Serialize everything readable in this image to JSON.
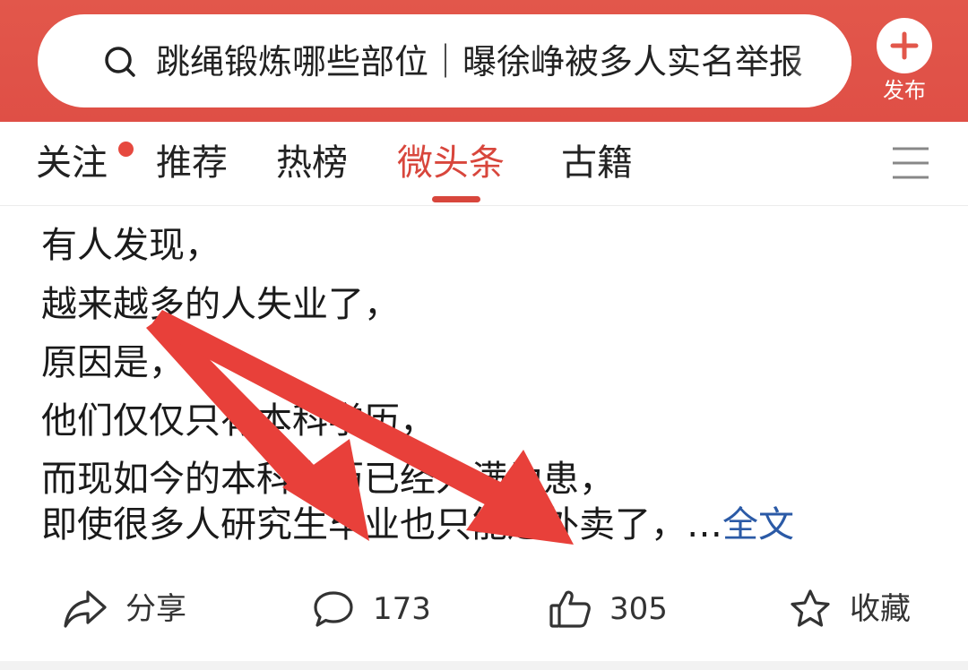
{
  "search": {
    "query": "跳绳锻炼哪些部位｜曝徐峥被多人实名举报"
  },
  "header": {
    "publish_label": "发布"
  },
  "tabs": [
    {
      "label": "关注",
      "has_dot": true
    },
    {
      "label": "推荐"
    },
    {
      "label": "热榜"
    },
    {
      "label": "微头条",
      "active": true
    },
    {
      "label": "古籍"
    }
  ],
  "post": {
    "lines": [
      "有人发现，",
      "越来越多的人失业了，",
      "原因是，",
      "他们仅仅只有本科学历，",
      "而现如今的本科学历已经人满为患，",
      "即使很多人研究生毕业也只能送外卖了，…"
    ],
    "full_text_link": "全文"
  },
  "actions": {
    "share": "分享",
    "comments": "173",
    "likes": "305",
    "favorite": "收藏"
  },
  "colors": {
    "header_red": "#e2574b",
    "active_tab": "#d8463c",
    "link_blue": "#2b5aa6",
    "annotation_arrow": "#e8403a"
  },
  "icons": [
    "search-icon",
    "plus-icon",
    "menu-icon",
    "share-icon",
    "comment-icon",
    "thumbs-up-icon",
    "star-icon"
  ]
}
